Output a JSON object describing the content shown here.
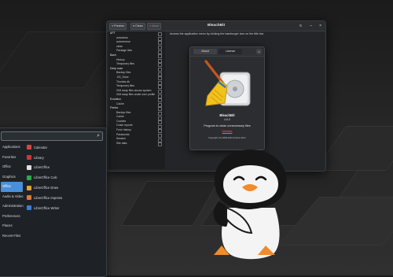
{
  "bleachbit": {
    "title": "BleachBit",
    "preview_label": "Preview",
    "clean_label": "Clean",
    "abort_label": "Abort",
    "hint": "Access the application menu by clicking the hamburger icon on the title bar.",
    "tree": [
      {
        "kind": "parent",
        "label": "APT"
      },
      {
        "kind": "child",
        "label": "autoclean"
      },
      {
        "kind": "child",
        "label": "autoremove"
      },
      {
        "kind": "child",
        "label": "clean"
      },
      {
        "kind": "child",
        "label": "Package lists"
      },
      {
        "kind": "parent",
        "label": "Bash"
      },
      {
        "kind": "child",
        "label": "History"
      },
      {
        "kind": "child",
        "label": "Temporary files"
      },
      {
        "kind": "parent",
        "label": "Deep scan"
      },
      {
        "kind": "child",
        "label": "Backup files"
      },
      {
        "kind": "child",
        "label": ".DS_Store"
      },
      {
        "kind": "child",
        "label": "Thumbs.db"
      },
      {
        "kind": "child",
        "label": "Temporary files"
      },
      {
        "kind": "child",
        "label": "VIM swap files across system"
      },
      {
        "kind": "child",
        "label": "VIM swap files under user profile"
      },
      {
        "kind": "parent",
        "label": "Evolution"
      },
      {
        "kind": "child",
        "label": "Cache"
      },
      {
        "kind": "parent",
        "label": "Firefox"
      },
      {
        "kind": "child",
        "label": "Backup files"
      },
      {
        "kind": "child",
        "label": "Cache"
      },
      {
        "kind": "child",
        "label": "Cookies"
      },
      {
        "kind": "child",
        "label": "Crash reports"
      },
      {
        "kind": "child",
        "label": "Form history"
      },
      {
        "kind": "child",
        "label": "Passwords"
      },
      {
        "kind": "child",
        "label": "Session"
      },
      {
        "kind": "child",
        "label": "Site data"
      }
    ]
  },
  "about": {
    "tab_about": "About",
    "tab_license": "License",
    "close": "×",
    "app_name": "BleachBit",
    "version": "4.6.0",
    "description": "Program to clean unnecessary files",
    "website": "Website",
    "copyright": "Copyright (C) 2008-2023 Andrew Ziem"
  },
  "app_menu": {
    "categories": [
      "Applications",
      "Favorites",
      "Office",
      "Graphics",
      "Office",
      "Audio & Video",
      "Administration",
      "Preferences",
      "Places",
      "Recent Files"
    ],
    "selected_category_index": 4,
    "apps": [
      {
        "label": "Calendar",
        "color": "#d64545"
      },
      {
        "label": "Library",
        "color": "#c43b3b"
      },
      {
        "label": "LibreOffice",
        "color": "#e0e0e0"
      },
      {
        "label": "LibreOffice Calc",
        "color": "#2fa84f"
      },
      {
        "label": "LibreOffice Draw",
        "color": "#e2a437"
      },
      {
        "label": "LibreOffice Impress",
        "color": "#e0783a"
      },
      {
        "label": "LibreOffice Writer",
        "color": "#3a7fd0"
      }
    ]
  },
  "icons": [
    "search-icon",
    "hamburger-menu-icon",
    "minimize-icon",
    "close-icon",
    "broom-icon",
    "penguin-mascot"
  ]
}
